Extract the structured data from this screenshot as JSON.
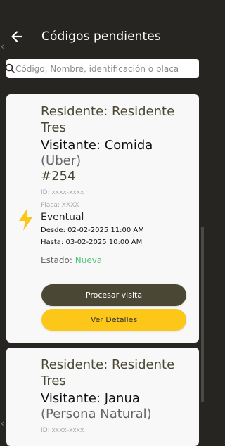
{
  "header": {
    "title": "Códigos pendientes"
  },
  "search": {
    "placeholder": "Código, Nombre, identificación o placa"
  },
  "cards": [
    {
      "resident": "Residente: Residente Tres",
      "visitor_name": "Visitante: Comida",
      "visitor_type": "(Uber)",
      "code": "#254",
      "id_line": "ID: xxxx-xxxx",
      "plate_line": "Placa: XXXX",
      "kind": "Eventual",
      "from": "Desde: 02-02-2025 11:00 AM",
      "to": "Hasta: 03-02-2025 10:00 AM",
      "status_label": "Estado:",
      "status_value": "Nueva",
      "process_label": "Procesar visita",
      "details_label": "Ver Detalles"
    },
    {
      "resident": "Residente: Residente Tres",
      "visitor_name": "Visitante: Janua",
      "visitor_type": "(Persona Natural)",
      "id_line": "ID: xxxx-xxxx"
    }
  ],
  "colors": {
    "accent": "#fcc719",
    "primary": "#4a4835",
    "status_new": "#4fc279"
  },
  "icons": {
    "back": "back-arrow-icon",
    "search": "search-icon",
    "type": "lightning-bolt-icon"
  }
}
